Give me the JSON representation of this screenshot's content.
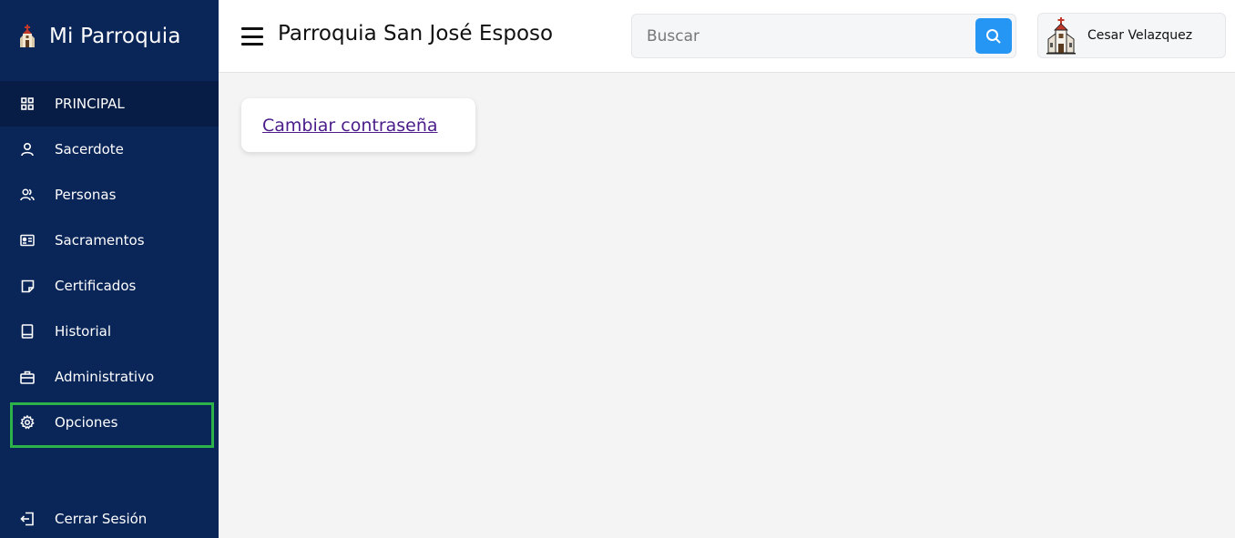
{
  "brand": {
    "name": "Mi Parroquia",
    "icon": "church-icon"
  },
  "sidebar": {
    "items": [
      {
        "label": "PRINCIPAL",
        "icon": "grid-icon",
        "active": true
      },
      {
        "label": "Sacerdote",
        "icon": "user-icon"
      },
      {
        "label": "Personas",
        "icon": "users-icon"
      },
      {
        "label": "Sacramentos",
        "icon": "id-card-icon"
      },
      {
        "label": "Certificados",
        "icon": "note-icon"
      },
      {
        "label": "Historial",
        "icon": "book-icon"
      },
      {
        "label": "Administrativo",
        "icon": "briefcase-icon"
      },
      {
        "label": "Opciones",
        "icon": "gear-icon",
        "highlighted": true
      }
    ],
    "logout": {
      "label": "Cerrar Sesión",
      "icon": "logout-icon"
    }
  },
  "header": {
    "title": "Parroquia San José Esposo",
    "search": {
      "placeholder": "Buscar",
      "value": ""
    },
    "user": {
      "name": "Cesar Velazquez"
    }
  },
  "main": {
    "card_link": "Cambiar contraseña"
  },
  "colors": {
    "sidebar_bg": "#0a2558",
    "active_item_bg": "#081d45",
    "highlight_border": "#2bb34a",
    "search_button": "#2696f5",
    "link": "#4b1c8a"
  }
}
